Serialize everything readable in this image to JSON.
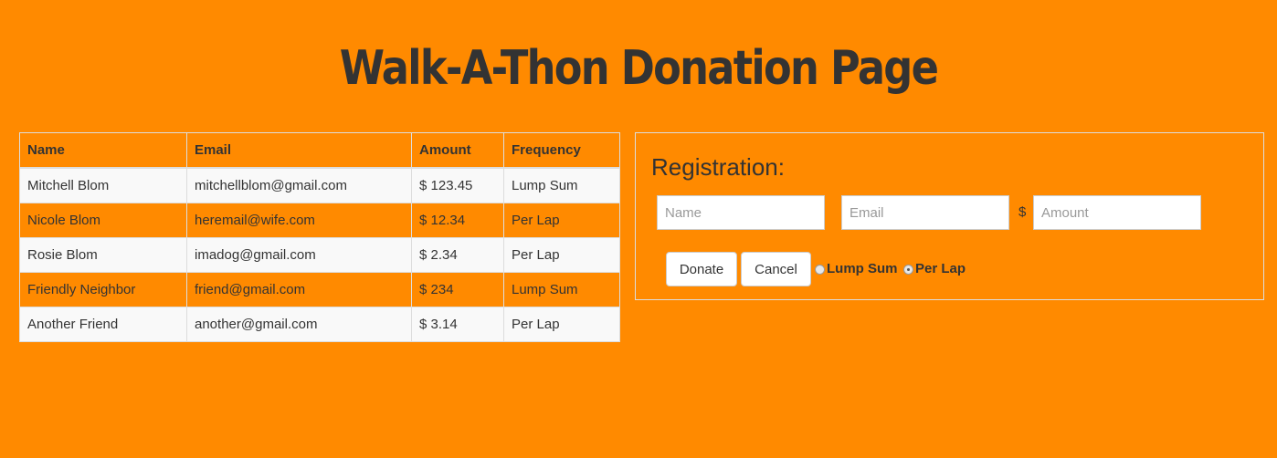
{
  "page": {
    "title": "Walk-A-Thon Donation Page"
  },
  "table": {
    "headers": {
      "name": "Name",
      "email": "Email",
      "amount": "Amount",
      "frequency": "Frequency"
    },
    "rows": [
      {
        "name": "Mitchell Blom",
        "email": "mitchellblom@gmail.com",
        "amount": "$ 123.45",
        "frequency": "Lump Sum"
      },
      {
        "name": "Nicole Blom",
        "email": "heremail@wife.com",
        "amount": "$ 12.34",
        "frequency": "Per Lap"
      },
      {
        "name": "Rosie Blom",
        "email": "imadog@gmail.com",
        "amount": "$ 2.34",
        "frequency": "Per Lap"
      },
      {
        "name": "Friendly Neighbor",
        "email": "friend@gmail.com",
        "amount": "$ 234",
        "frequency": "Lump Sum"
      },
      {
        "name": "Another Friend",
        "email": "another@gmail.com",
        "amount": "$ 3.14",
        "frequency": "Per Lap"
      }
    ]
  },
  "registration": {
    "heading": "Registration:",
    "name_placeholder": "Name",
    "email_placeholder": "Email",
    "currency_symbol": "$",
    "amount_placeholder": "Amount",
    "donate_label": "Donate",
    "cancel_label": "Cancel",
    "lump_sum_label": "Lump Sum",
    "per_lap_label": "Per Lap",
    "selected_frequency": "Per Lap"
  },
  "colors": {
    "background": "#FF8A00",
    "text": "#333333",
    "light_row": "#F9F9F9",
    "border": "#DDDDDD"
  }
}
